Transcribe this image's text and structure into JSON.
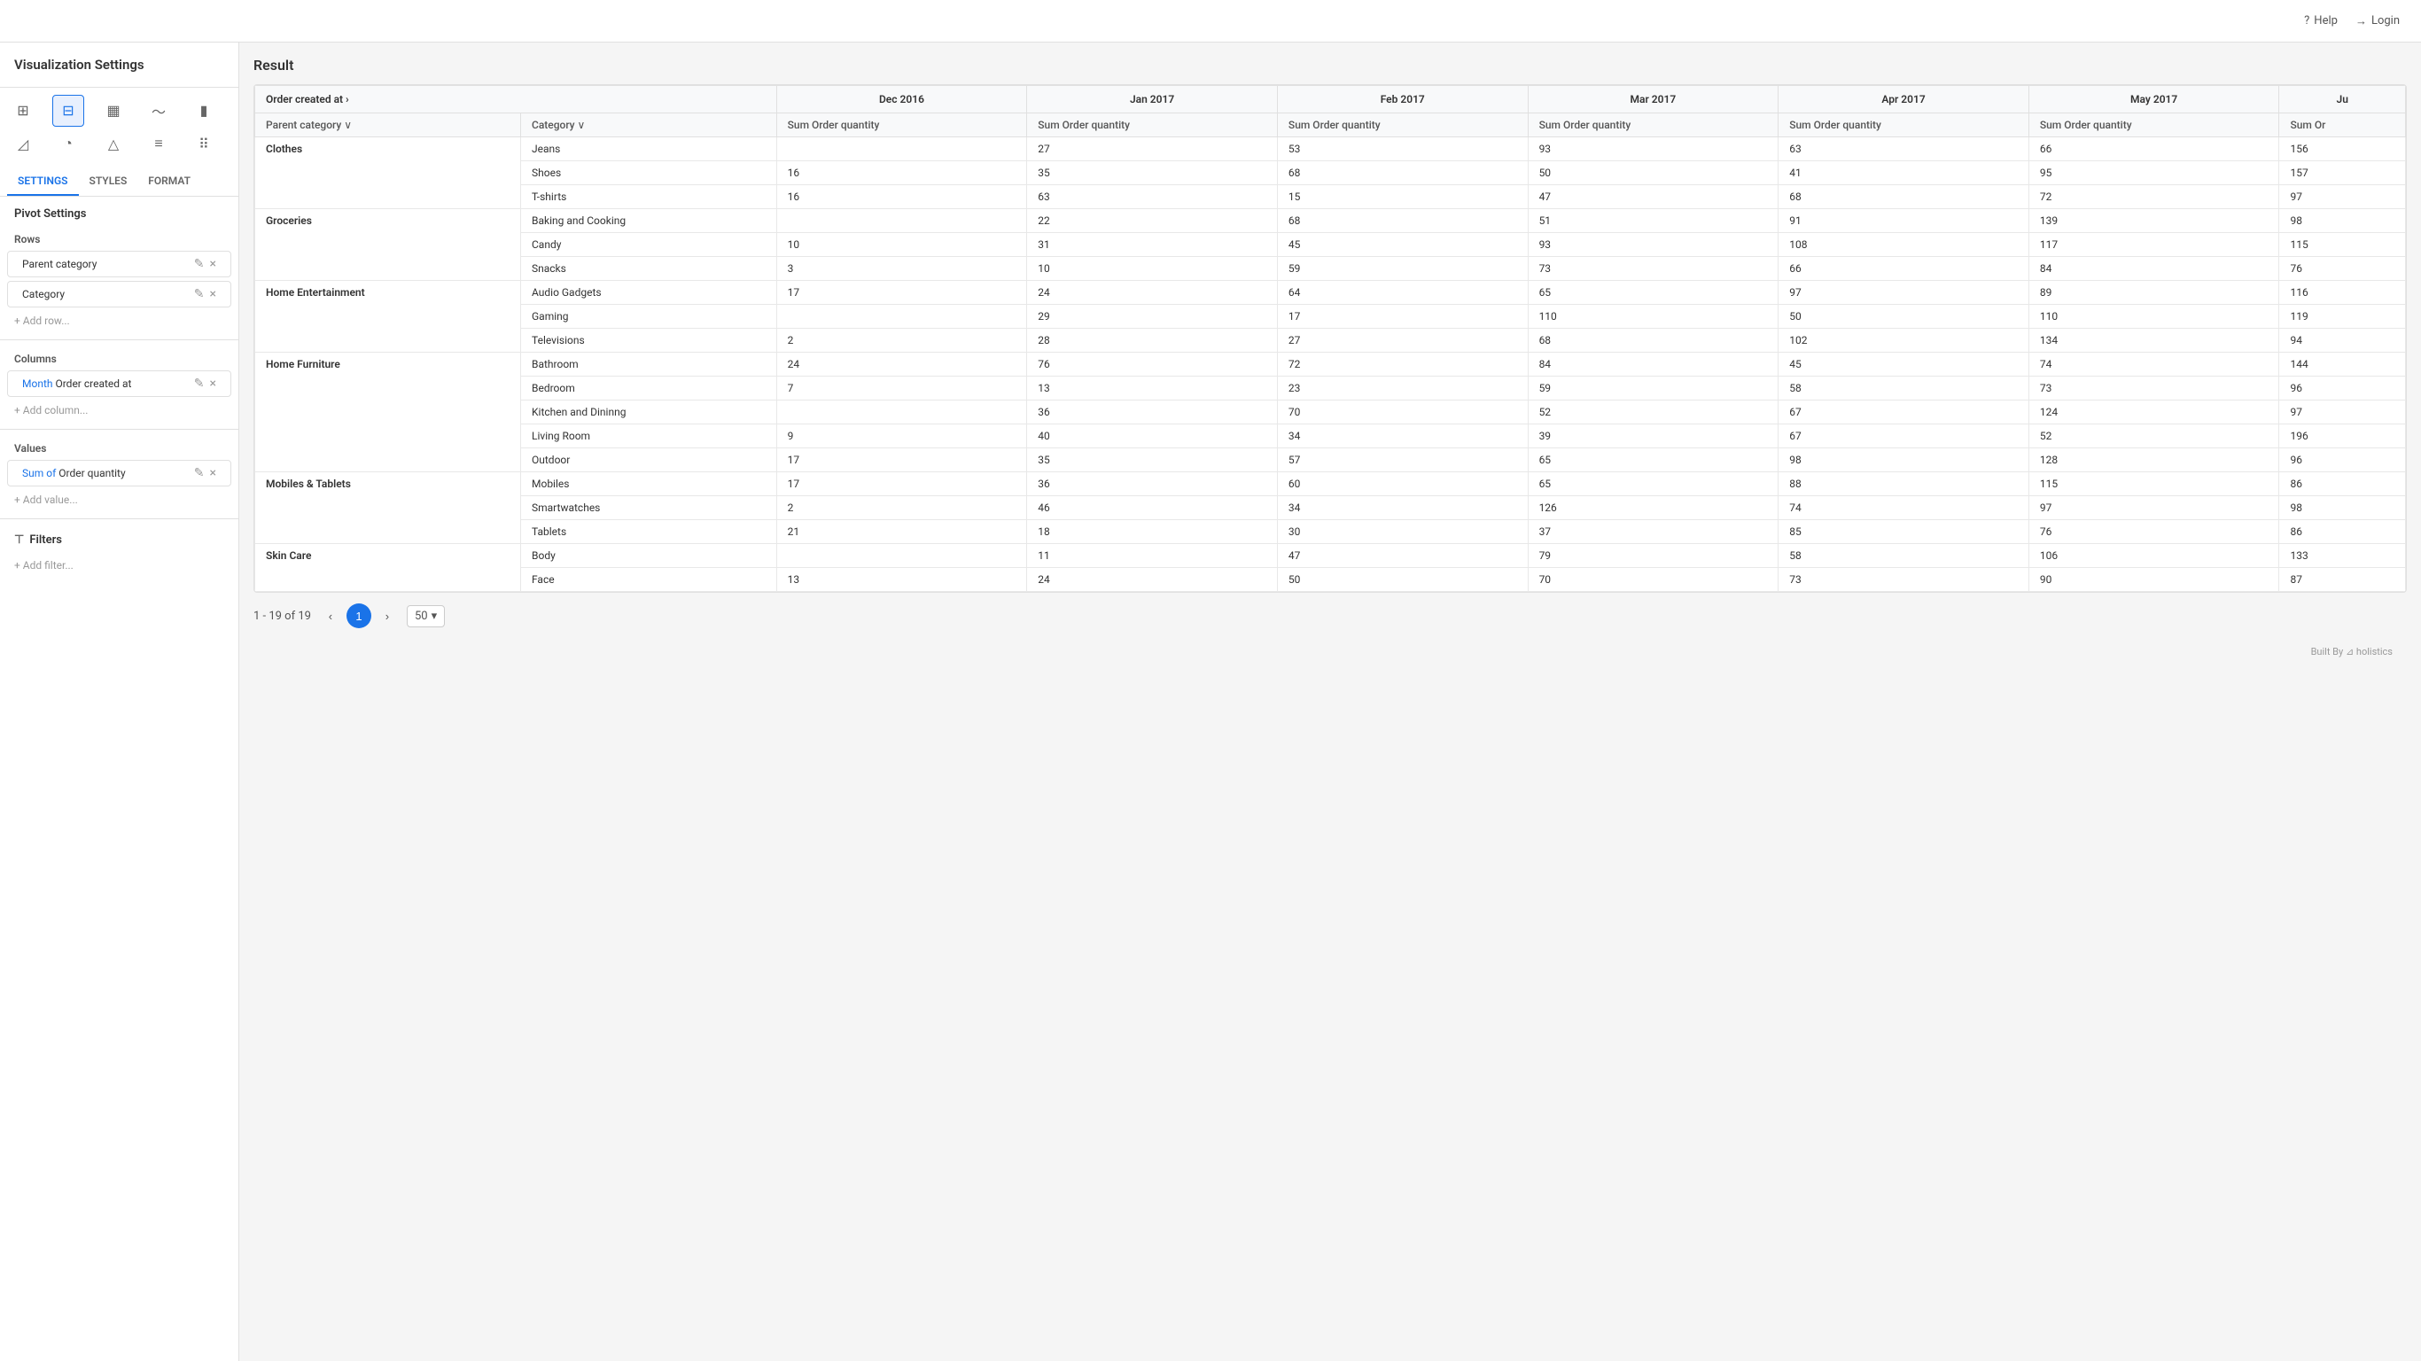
{
  "topbar": {
    "help_label": "Help",
    "login_label": "Login"
  },
  "sidebar": {
    "title": "Visualization Settings",
    "tabs": [
      "SETTINGS",
      "STYLES",
      "FORMAT"
    ],
    "active_tab": "SETTINGS",
    "pivot_settings_title": "Pivot Settings",
    "rows_label": "Rows",
    "columns_label": "Columns",
    "values_label": "Values",
    "filters_label": "Filters",
    "rows": [
      {
        "label": "Parent category",
        "id": "parent-category"
      },
      {
        "label": "Category",
        "id": "category"
      }
    ],
    "columns": [
      {
        "label": "Month",
        "label_blue": "Month",
        "label_rest": " Order created at",
        "id": "month-order-created"
      }
    ],
    "values": [
      {
        "label": "Sum of",
        "label_blue": "Sum of",
        "label_rest": " Order quantity",
        "id": "sum-order-quantity"
      }
    ],
    "add_row_label": "+ Add row...",
    "add_column_label": "+ Add column...",
    "add_value_label": "+ Add value...",
    "add_filter_label": "+ Add filter..."
  },
  "result": {
    "title": "Result",
    "table": {
      "col_header_1": "Order created at ›",
      "col_header_parent": "Parent category ∨",
      "col_header_category": "Category ∨",
      "months": [
        "Dec 2016",
        "Jan 2017",
        "Feb 2017",
        "Mar 2017",
        "Apr 2017",
        "May 2017",
        "Ju"
      ],
      "sum_label": "Sum Order quantity",
      "sum_label_short": "Sum Or",
      "rows": [
        {
          "parent": "Clothes",
          "categories": [
            {
              "name": "Jeans",
              "dec2016": "",
              "jan2017": "27",
              "feb2017": "53",
              "mar2017": "93",
              "apr2017": "63",
              "may2017": "66",
              "jun": "156"
            },
            {
              "name": "Shoes",
              "dec2016": "16",
              "jan2017": "35",
              "feb2017": "68",
              "mar2017": "50",
              "apr2017": "41",
              "may2017": "95",
              "jun": "157"
            },
            {
              "name": "T-shirts",
              "dec2016": "16",
              "jan2017": "63",
              "feb2017": "15",
              "mar2017": "47",
              "apr2017": "68",
              "may2017": "72",
              "jun": "97"
            }
          ]
        },
        {
          "parent": "Groceries",
          "categories": [
            {
              "name": "Baking and Cooking",
              "dec2016": "",
              "jan2017": "22",
              "feb2017": "68",
              "mar2017": "51",
              "apr2017": "91",
              "may2017": "139",
              "jun": "98"
            },
            {
              "name": "Candy",
              "dec2016": "10",
              "jan2017": "31",
              "feb2017": "45",
              "mar2017": "93",
              "apr2017": "108",
              "may2017": "117",
              "jun": "115"
            },
            {
              "name": "Snacks",
              "dec2016": "3",
              "jan2017": "10",
              "feb2017": "59",
              "mar2017": "73",
              "apr2017": "66",
              "may2017": "84",
              "jun": "76"
            }
          ]
        },
        {
          "parent": "Home Entertainment",
          "categories": [
            {
              "name": "Audio Gadgets",
              "dec2016": "17",
              "jan2017": "24",
              "feb2017": "64",
              "mar2017": "65",
              "apr2017": "97",
              "may2017": "89",
              "jun": "116"
            },
            {
              "name": "Gaming",
              "dec2016": "",
              "jan2017": "29",
              "feb2017": "17",
              "mar2017": "110",
              "apr2017": "50",
              "may2017": "110",
              "jun": "119"
            },
            {
              "name": "Televisions",
              "dec2016": "2",
              "jan2017": "28",
              "feb2017": "27",
              "mar2017": "68",
              "apr2017": "102",
              "may2017": "134",
              "jun": "94"
            }
          ]
        },
        {
          "parent": "Home Furniture",
          "categories": [
            {
              "name": "Bathroom",
              "dec2016": "24",
              "jan2017": "76",
              "feb2017": "72",
              "mar2017": "84",
              "apr2017": "45",
              "may2017": "74",
              "jun": "144"
            },
            {
              "name": "Bedroom",
              "dec2016": "7",
              "jan2017": "13",
              "feb2017": "23",
              "mar2017": "59",
              "apr2017": "58",
              "may2017": "73",
              "jun": "96"
            },
            {
              "name": "Kitchen and Dininng",
              "dec2016": "",
              "jan2017": "36",
              "feb2017": "70",
              "mar2017": "52",
              "apr2017": "67",
              "may2017": "124",
              "jun": "97"
            },
            {
              "name": "Living Room",
              "dec2016": "9",
              "jan2017": "40",
              "feb2017": "34",
              "mar2017": "39",
              "apr2017": "67",
              "may2017": "52",
              "jun": "196"
            },
            {
              "name": "Outdoor",
              "dec2016": "17",
              "jan2017": "35",
              "feb2017": "57",
              "mar2017": "65",
              "apr2017": "98",
              "may2017": "128",
              "jun": "96"
            }
          ]
        },
        {
          "parent": "Mobiles & Tablets",
          "categories": [
            {
              "name": "Mobiles",
              "dec2016": "17",
              "jan2017": "36",
              "feb2017": "60",
              "mar2017": "65",
              "apr2017": "88",
              "may2017": "115",
              "jun": "86"
            },
            {
              "name": "Smartwatches",
              "dec2016": "2",
              "jan2017": "46",
              "feb2017": "34",
              "mar2017": "126",
              "apr2017": "74",
              "may2017": "97",
              "jun": "98"
            },
            {
              "name": "Tablets",
              "dec2016": "21",
              "jan2017": "18",
              "feb2017": "30",
              "mar2017": "37",
              "apr2017": "85",
              "may2017": "76",
              "jun": "86"
            }
          ]
        },
        {
          "parent": "Skin Care",
          "categories": [
            {
              "name": "Body",
              "dec2016": "",
              "jan2017": "11",
              "feb2017": "47",
              "mar2017": "79",
              "apr2017": "58",
              "may2017": "106",
              "jun": "133"
            },
            {
              "name": "Face",
              "dec2016": "13",
              "jan2017": "24",
              "feb2017": "50",
              "mar2017": "70",
              "apr2017": "73",
              "may2017": "90",
              "jun": "87"
            }
          ]
        }
      ]
    },
    "pagination": {
      "range": "1 - 19 of 19",
      "current_page": "1",
      "per_page": "50"
    }
  },
  "footer": {
    "label": "Built By",
    "brand": "holistics"
  },
  "icons": {
    "table": "⊞",
    "pivot": "⊟",
    "bar_chart": "▦",
    "line_chart": "〜",
    "column_chart": "▮",
    "list": "☰",
    "area_chart": "◿",
    "pie_chart": "◔",
    "funnel": "⌂",
    "filter": "≡",
    "scatter": "⠿",
    "more": "⋯",
    "help": "?",
    "login": "→",
    "edit": "✎",
    "close": "×",
    "prev": "‹",
    "next": "›",
    "down": "▾"
  }
}
